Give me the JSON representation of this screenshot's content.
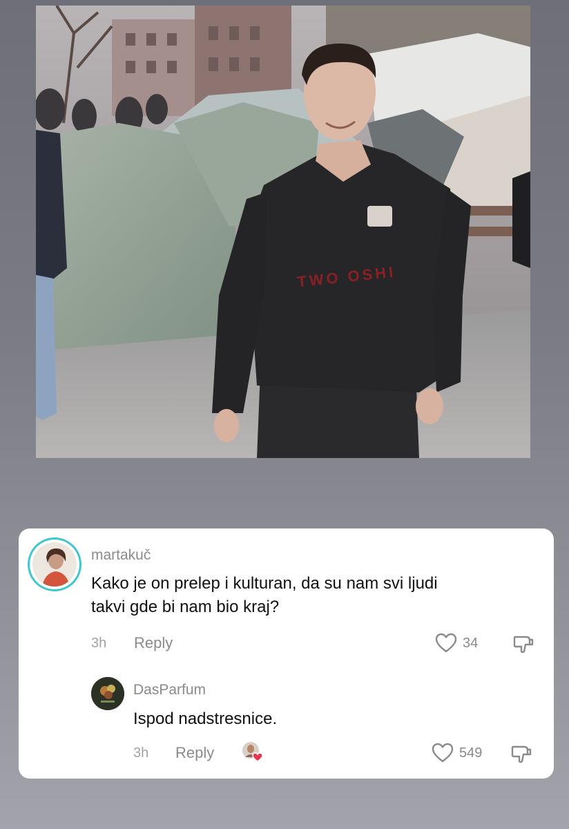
{
  "photo": {
    "description_icon": "photo",
    "shirt_text": "TWO OSHI"
  },
  "comment": {
    "username": "martakuč",
    "text_line1": "Kako je on prelep i kulturan, da su nam svi ljudi",
    "text_line2": "takvi gde bi nam bio kraj?",
    "time": "3h",
    "reply_label": "Reply",
    "likes": "34"
  },
  "reply": {
    "username": "DasParfum",
    "text": "Ispod nadstresnice.",
    "time": "3h",
    "reply_label": "Reply",
    "likes": "549"
  },
  "colors": {
    "avatar_ring": "#3ec7d3",
    "creator_heart": "#e8344f"
  },
  "icons": [
    "heart-icon",
    "dislike-icon",
    "creator-liked-badge"
  ]
}
